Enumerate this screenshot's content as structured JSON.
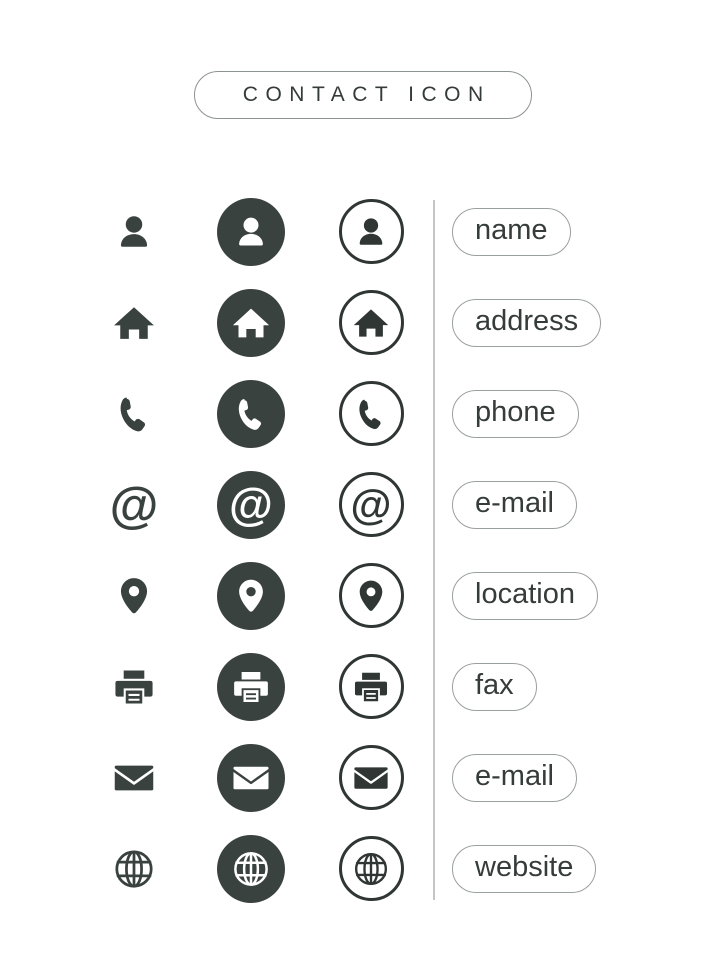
{
  "header": {
    "title": "CONTACT ICON"
  },
  "legend": {
    "columns": [
      "plain",
      "filled-circle",
      "outlined-circle",
      "label"
    ]
  },
  "colors": {
    "dark": "#3a423f",
    "outline": "#2f3634",
    "pill_border": "#9aa09d",
    "title_border": "#8d9390",
    "divider": "#c2c6c4",
    "background": "#ffffff"
  },
  "rows": [
    {
      "icon": "person-icon",
      "label": "name"
    },
    {
      "icon": "home-icon",
      "label": "address"
    },
    {
      "icon": "phone-icon",
      "label": "phone"
    },
    {
      "icon": "at-icon",
      "label": "e-mail"
    },
    {
      "icon": "location-icon",
      "label": "location"
    },
    {
      "icon": "printer-icon",
      "label": "fax"
    },
    {
      "icon": "envelope-icon",
      "label": "e-mail"
    },
    {
      "icon": "globe-icon",
      "label": "website"
    }
  ],
  "glyphs": {
    "at": "@"
  }
}
